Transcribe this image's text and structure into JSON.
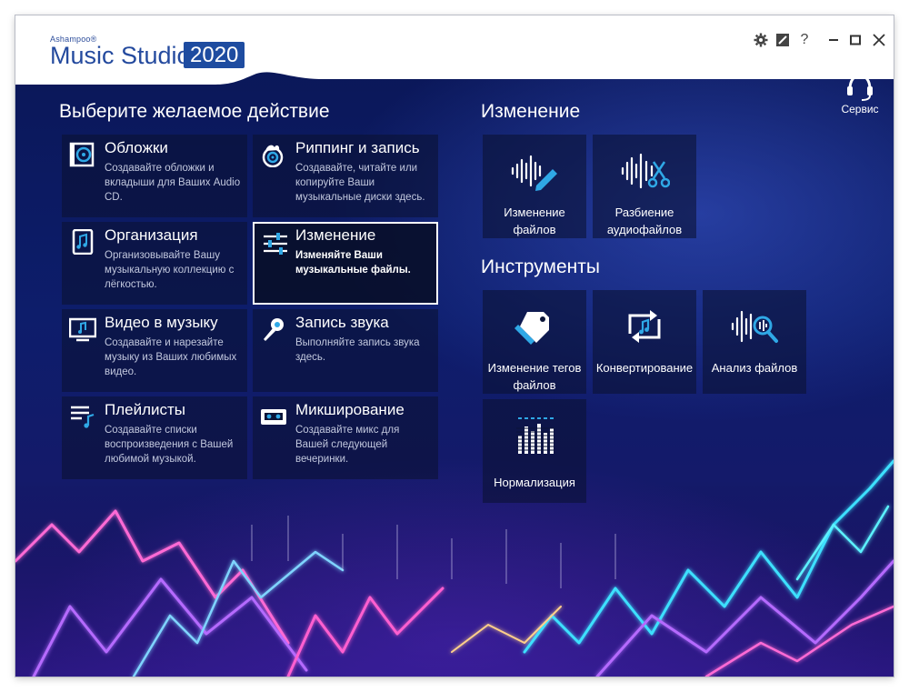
{
  "app": {
    "brand_small": "Ashampoo®",
    "brand_name": "Music Studio",
    "brand_year": "2020"
  },
  "window_controls": {
    "settings_icon": "gear-icon",
    "skin_icon": "brush-icon",
    "help_label": "?",
    "minimize_icon": "minimize-icon",
    "maximize_icon": "maximize-icon",
    "close_icon": "close-icon"
  },
  "service": {
    "label": "Сервис",
    "icon": "headset-icon"
  },
  "actions": {
    "heading": "Выберите желаемое действие",
    "tiles": [
      {
        "title": "Обложки",
        "desc": "Создавайте обложки и вкладыши для Ваших Audio CD.",
        "icon": "cd-case-icon"
      },
      {
        "title": "Риппинг и запись",
        "desc": "Создавайте, читайте или копируйте Ваши музыкальные диски здесь.",
        "icon": "disc-burn-icon"
      },
      {
        "title": "Организация",
        "desc": "Организовывайте Вашу музыкальную коллекцию с лёгкостью.",
        "icon": "music-file-icon"
      },
      {
        "title": "Изменение",
        "desc": "Изменяйте Ваши музыкальные файлы.",
        "icon": "sliders-icon"
      },
      {
        "title": "Видео в музыку",
        "desc": "Создавайте и нарезайте музыку из Ваших любимых видео.",
        "icon": "monitor-music-icon"
      },
      {
        "title": "Запись звука",
        "desc": "Выполняйте запись звука здесь.",
        "icon": "microphone-icon"
      },
      {
        "title": "Плейлисты",
        "desc": "Создавайте списки воспроизведения с Вашей любимой музыкой.",
        "icon": "playlist-icon"
      },
      {
        "title": "Микширование",
        "desc": "Создавайте микс для Вашей следующей вечеринки.",
        "icon": "cassette-icon"
      }
    ]
  },
  "editing": {
    "heading": "Изменение",
    "tools": [
      {
        "label": "Изменение файлов",
        "icon": "waveform-pencil-icon"
      },
      {
        "label": "Разбиение аудиофайлов",
        "icon": "waveform-scissors-icon"
      }
    ]
  },
  "instruments": {
    "heading": "Инструменты",
    "tools": [
      {
        "label": "Изменение тегов файлов",
        "icon": "tag-icon"
      },
      {
        "label": "Конвертирование",
        "icon": "convert-icon"
      },
      {
        "label": "Анализ файлов",
        "icon": "waveform-magnifier-icon"
      },
      {
        "label": "Нормализация",
        "icon": "equalizer-icon"
      }
    ]
  },
  "colors": {
    "accent": "#1e4ca0",
    "icon_blue": "#2fa8e6",
    "background": "#0c1a5e",
    "tile_bg": "#0a1232",
    "selected_border": "#ffffff"
  }
}
